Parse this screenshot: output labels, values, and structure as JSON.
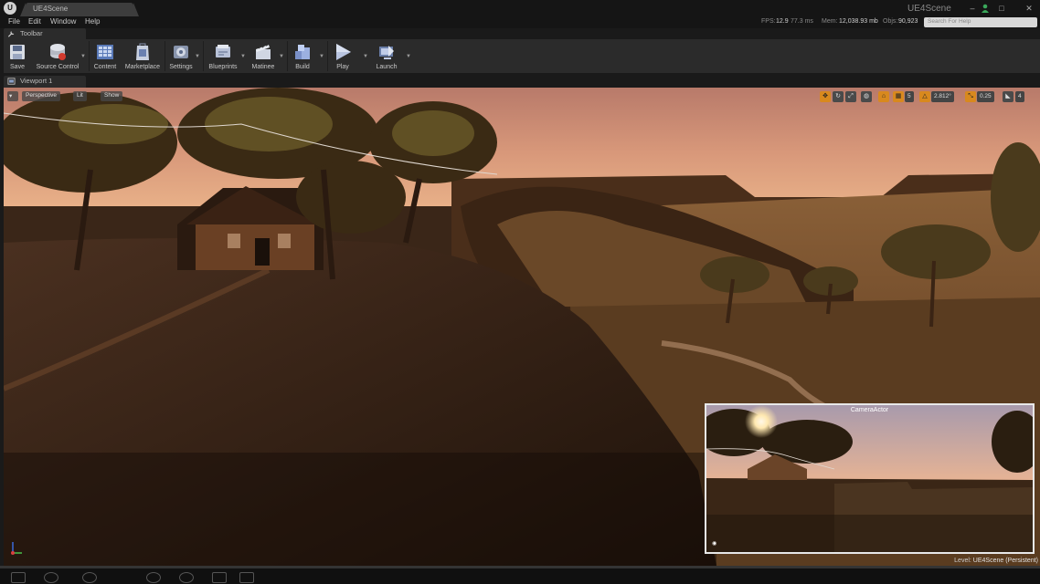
{
  "window": {
    "tab_title": "UE4Scene",
    "app_name": "UE4Scene",
    "logo_text": "U",
    "minimize": "–",
    "restore": "□",
    "close": "✕"
  },
  "menu": [
    "File",
    "Edit",
    "Window",
    "Help"
  ],
  "stats": {
    "fps_label": "FPS:",
    "fps_value": "12.9",
    "ms_value": "77.3 ms",
    "mem_label": "Mem:",
    "mem_value": "12,038.93 mb",
    "objs_label": "Objs:",
    "objs_value": "90,923"
  },
  "help_search": {
    "placeholder": "Search For Help"
  },
  "toolbar_tab": "Toolbar",
  "toolbar": [
    {
      "label": "Save",
      "icon": "save-icon"
    },
    {
      "label": "Source Control",
      "icon": "source-control-icon"
    },
    {
      "label": "Content",
      "icon": "content-browser-icon"
    },
    {
      "label": "Marketplace",
      "icon": "marketplace-icon"
    },
    {
      "label": "Settings",
      "icon": "settings-icon"
    },
    {
      "label": "Blueprints",
      "icon": "blueprints-icon"
    },
    {
      "label": "Matinee",
      "icon": "matinee-icon"
    },
    {
      "label": "Build",
      "icon": "build-icon"
    },
    {
      "label": "Play",
      "icon": "play-icon"
    },
    {
      "label": "Launch",
      "icon": "launch-icon"
    }
  ],
  "viewport_tab": "Viewport 1",
  "viewport": {
    "menu_arrow": "▾",
    "perspective": "Perspective",
    "lit": "Lit",
    "show": "Show",
    "snap_grid": "5",
    "snap_rotation": "2.812°",
    "snap_scale": "0.25",
    "camera_speed": "4"
  },
  "preview": {
    "title": "CameraActor"
  },
  "level": {
    "label": "Level:",
    "value": "UE4Scene (Persistent)"
  },
  "colors": {
    "accent": "#d8891e",
    "background": "#151515",
    "panel": "#2b2b2b"
  }
}
